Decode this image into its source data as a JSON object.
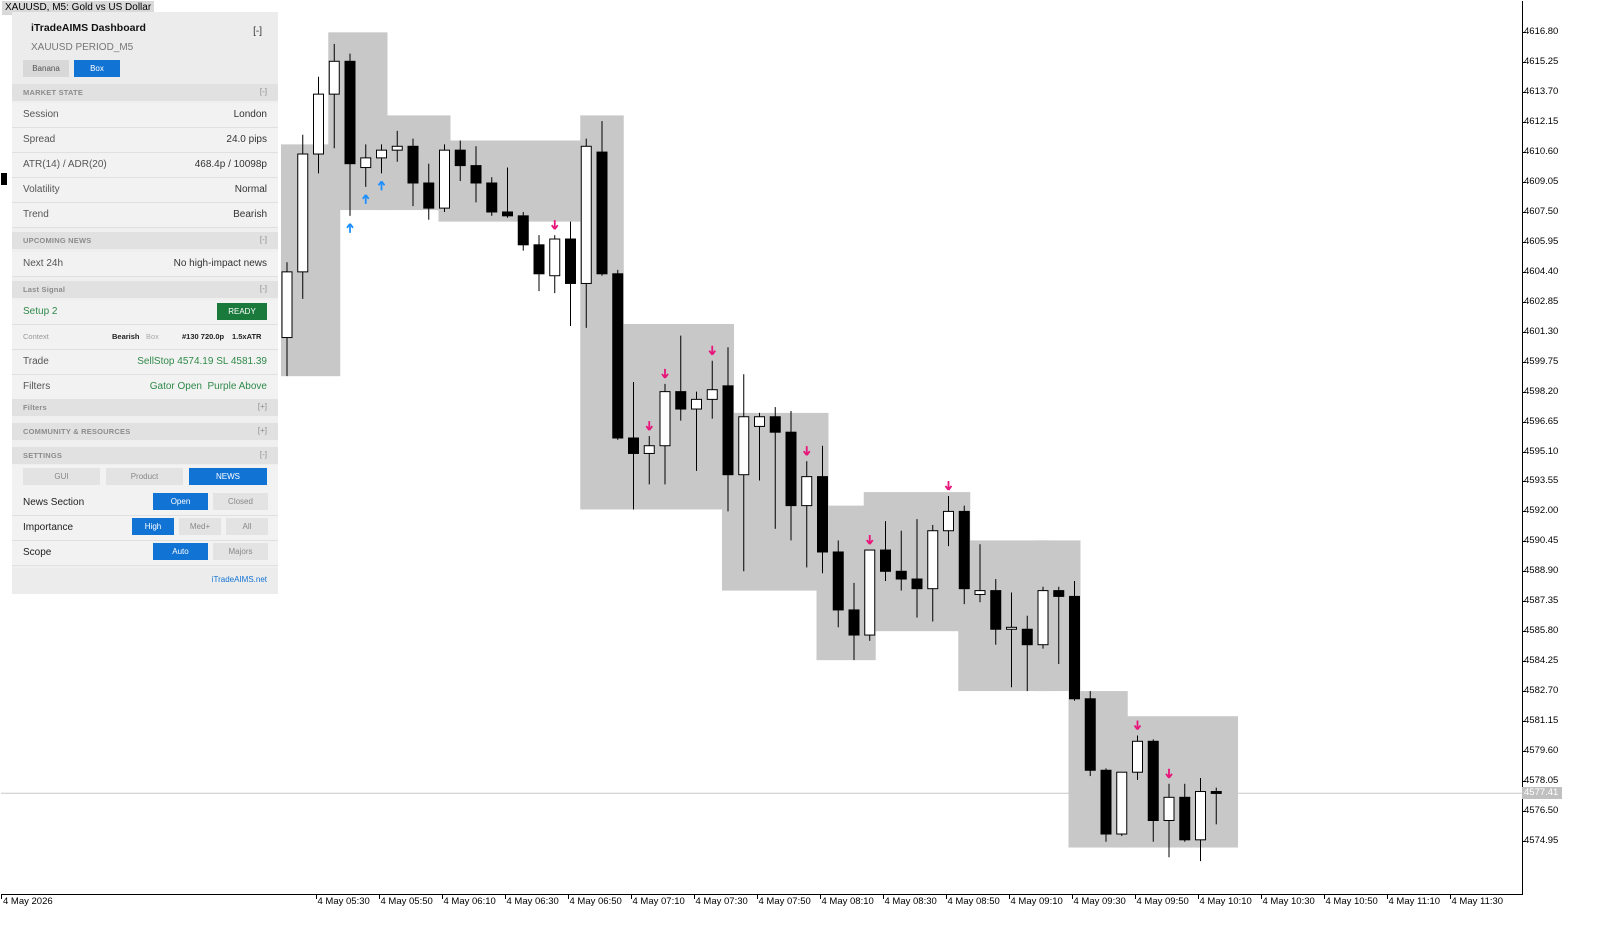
{
  "symbol_title": "XAUUSD, M5:  Gold vs US Dollar",
  "current_price": "4577.41",
  "price_scale": {
    "min": 4573.8,
    "max": 4617.8
  },
  "price_labels": [
    "4616.80",
    "4615.25",
    "4613.70",
    "4612.15",
    "4610.60",
    "4609.05",
    "4607.50",
    "4605.95",
    "4604.40",
    "4602.85",
    "4601.30",
    "4599.75",
    "4598.20",
    "4596.65",
    "4595.10",
    "4593.55",
    "4592.00",
    "4590.45",
    "4588.90",
    "4587.35",
    "4585.80",
    "4584.25",
    "4582.70",
    "4581.15",
    "4579.60",
    "4578.05",
    "4576.50",
    "4574.95"
  ],
  "time_labels": [
    "4 May 2026",
    "4 May 05:30",
    "4 May 05:50",
    "4 May 06:10",
    "4 May 06:30",
    "4 May 06:50",
    "4 May 07:10",
    "4 May 07:30",
    "4 May 07:50",
    "4 May 08:10",
    "4 May 08:30",
    "4 May 08:50",
    "4 May 09:10",
    "4 May 09:30",
    "4 May 09:50",
    "4 May 10:10",
    "4 May 10:30",
    "4 May 10:50",
    "4 May 11:10",
    "4 May 11:30"
  ],
  "colors": {
    "bull": "#ffffff",
    "bear": "#000000",
    "box": "#c8c8c8",
    "arrow_up": "#1e90ff",
    "arrow_down": "#e8157a",
    "accent": "#1173d4",
    "ready": "#1a7a3c"
  },
  "chart_data": {
    "type": "candlestick",
    "timeframe": "M5",
    "candles": [
      {
        "o": 4601.0,
        "h": 4604.9,
        "l": 4599.0,
        "c": 4604.4
      },
      {
        "o": 4604.4,
        "h": 4611.5,
        "l": 4603.0,
        "c": 4610.5
      },
      {
        "o": 4610.5,
        "h": 4614.5,
        "l": 4609.5,
        "c": 4613.6
      },
      {
        "o": 4613.6,
        "h": 4616.2,
        "l": 4610.8,
        "c": 4615.3
      },
      {
        "o": 4615.3,
        "h": 4615.7,
        "l": 4607.3,
        "c": 4610.0
      },
      {
        "o": 4609.8,
        "h": 4611.0,
        "l": 4608.8,
        "c": 4610.3
      },
      {
        "o": 4610.3,
        "h": 4611.0,
        "l": 4609.5,
        "c": 4610.7
      },
      {
        "o": 4610.7,
        "h": 4611.7,
        "l": 4610.1,
        "c": 4610.9
      },
      {
        "o": 4610.9,
        "h": 4611.3,
        "l": 4607.8,
        "c": 4609.0
      },
      {
        "o": 4609.0,
        "h": 4610.0,
        "l": 4607.1,
        "c": 4607.7
      },
      {
        "o": 4607.7,
        "h": 4611.0,
        "l": 4607.5,
        "c": 4610.7
      },
      {
        "o": 4610.7,
        "h": 4611.2,
        "l": 4609.1,
        "c": 4609.9
      },
      {
        "o": 4609.9,
        "h": 4610.9,
        "l": 4608.0,
        "c": 4609.0
      },
      {
        "o": 4609.0,
        "h": 4609.3,
        "l": 4607.3,
        "c": 4607.5
      },
      {
        "o": 4607.5,
        "h": 4609.8,
        "l": 4607.2,
        "c": 4607.3
      },
      {
        "o": 4607.3,
        "h": 4607.5,
        "l": 4605.5,
        "c": 4605.8
      },
      {
        "o": 4605.8,
        "h": 4606.3,
        "l": 4603.4,
        "c": 4604.3
      },
      {
        "o": 4604.2,
        "h": 4606.3,
        "l": 4603.3,
        "c": 4606.1
      },
      {
        "o": 4606.1,
        "h": 4607.0,
        "l": 4601.6,
        "c": 4603.8
      },
      {
        "o": 4603.8,
        "h": 4611.3,
        "l": 4601.5,
        "c": 4610.9
      },
      {
        "o": 4610.6,
        "h": 4612.2,
        "l": 4604.2,
        "c": 4604.3
      },
      {
        "o": 4604.3,
        "h": 4604.5,
        "l": 4595.7,
        "c": 4595.8
      },
      {
        "o": 4595.8,
        "h": 4598.7,
        "l": 4592.1,
        "c": 4595.0
      },
      {
        "o": 4595.0,
        "h": 4595.9,
        "l": 4593.4,
        "c": 4595.4
      },
      {
        "o": 4595.4,
        "h": 4598.6,
        "l": 4593.4,
        "c": 4598.2
      },
      {
        "o": 4598.2,
        "h": 4601.1,
        "l": 4596.7,
        "c": 4597.3
      },
      {
        "o": 4597.3,
        "h": 4598.2,
        "l": 4594.1,
        "c": 4597.8
      },
      {
        "o": 4597.8,
        "h": 4599.8,
        "l": 4596.8,
        "c": 4598.3
      },
      {
        "o": 4598.5,
        "h": 4600.5,
        "l": 4592.0,
        "c": 4593.9
      },
      {
        "o": 4593.9,
        "h": 4599.1,
        "l": 4588.9,
        "c": 4596.9
      },
      {
        "o": 4596.4,
        "h": 4597.1,
        "l": 4593.6,
        "c": 4596.9
      },
      {
        "o": 4596.9,
        "h": 4597.4,
        "l": 4591.1,
        "c": 4596.1
      },
      {
        "o": 4596.1,
        "h": 4597.2,
        "l": 4590.5,
        "c": 4592.3
      },
      {
        "o": 4592.3,
        "h": 4594.6,
        "l": 4589.1,
        "c": 4593.8
      },
      {
        "o": 4593.8,
        "h": 4595.4,
        "l": 4588.8,
        "c": 4589.9
      },
      {
        "o": 4589.9,
        "h": 4590.5,
        "l": 4586.0,
        "c": 4586.9
      },
      {
        "o": 4586.9,
        "h": 4588.3,
        "l": 4584.3,
        "c": 4585.6
      },
      {
        "o": 4585.6,
        "h": 4590.0,
        "l": 4585.3,
        "c": 4590.0
      },
      {
        "o": 4590.0,
        "h": 4591.5,
        "l": 4588.4,
        "c": 4588.9
      },
      {
        "o": 4588.9,
        "h": 4591.0,
        "l": 4587.9,
        "c": 4588.5
      },
      {
        "o": 4588.5,
        "h": 4591.6,
        "l": 4586.5,
        "c": 4588.0
      },
      {
        "o": 4588.0,
        "h": 4591.3,
        "l": 4586.3,
        "c": 4591.0
      },
      {
        "o": 4591.0,
        "h": 4592.8,
        "l": 4590.2,
        "c": 4592.0
      },
      {
        "o": 4592.0,
        "h": 4592.3,
        "l": 4587.2,
        "c": 4588.0
      },
      {
        "o": 4587.7,
        "h": 4590.3,
        "l": 4587.3,
        "c": 4587.9
      },
      {
        "o": 4587.9,
        "h": 4588.5,
        "l": 4585.1,
        "c": 4585.9
      },
      {
        "o": 4585.9,
        "h": 4587.8,
        "l": 4582.9,
        "c": 4586.0
      },
      {
        "o": 4585.9,
        "h": 4586.6,
        "l": 4582.7,
        "c": 4585.1
      },
      {
        "o": 4585.1,
        "h": 4588.1,
        "l": 4584.9,
        "c": 4587.9
      },
      {
        "o": 4587.9,
        "h": 4588.1,
        "l": 4584.1,
        "c": 4587.6
      },
      {
        "o": 4587.6,
        "h": 4588.4,
        "l": 4582.2,
        "c": 4582.3
      },
      {
        "o": 4582.3,
        "h": 4582.7,
        "l": 4578.3,
        "c": 4578.6
      },
      {
        "o": 4578.6,
        "h": 4578.7,
        "l": 4574.9,
        "c": 4575.3
      },
      {
        "o": 4575.3,
        "h": 4578.4,
        "l": 4575.2,
        "c": 4578.5
      },
      {
        "o": 4578.5,
        "h": 4580.4,
        "l": 4578.1,
        "c": 4580.1
      },
      {
        "o": 4580.1,
        "h": 4580.2,
        "l": 4574.9,
        "c": 4576.0
      },
      {
        "o": 4576.0,
        "h": 4577.9,
        "l": 4574.1,
        "c": 4577.2
      },
      {
        "o": 4577.2,
        "h": 4577.9,
        "l": 4574.9,
        "c": 4575.0
      },
      {
        "o": 4575.0,
        "h": 4578.2,
        "l": 4573.9,
        "c": 4577.5
      },
      {
        "o": 4577.5,
        "h": 4577.7,
        "l": 4575.8,
        "c": 4577.4
      }
    ],
    "boxes": [
      {
        "from": 0,
        "to": 3,
        "top": 4611.0,
        "bottom": 4599.0
      },
      {
        "from": 3,
        "to": 6,
        "top": 4616.8,
        "bottom": 4607.6
      },
      {
        "from": 6,
        "to": 10,
        "top": 4612.5,
        "bottom": 4607.6
      },
      {
        "from": 10,
        "to": 19,
        "top": 4611.2,
        "bottom": 4607.0
      },
      {
        "from": 19,
        "to": 21,
        "top": 4612.5,
        "bottom": 4592.1
      },
      {
        "from": 21,
        "to": 28,
        "top": 4601.7,
        "bottom": 4592.1
      },
      {
        "from": 28,
        "to": 34,
        "top": 4597.1,
        "bottom": 4587.9
      },
      {
        "from": 34,
        "to": 37,
        "top": 4592.3,
        "bottom": 4584.3
      },
      {
        "from": 37,
        "to": 43,
        "top": 4593.0,
        "bottom": 4585.8
      },
      {
        "from": 43,
        "to": 48,
        "top": 4590.5,
        "bottom": 4582.7
      },
      {
        "from": 48,
        "to": 50,
        "top": 4590.5,
        "bottom": 4582.7
      },
      {
        "from": 50,
        "to": 53,
        "top": 4582.7,
        "bottom": 4574.6
      },
      {
        "from": 53,
        "to": 60,
        "top": 4581.4,
        "bottom": 4574.6
      }
    ],
    "arrows_up": [
      4,
      5,
      6
    ],
    "arrows_down": [
      17,
      23,
      24,
      27,
      33,
      37,
      42,
      54,
      56
    ]
  },
  "dashboard": {
    "title": "iTradeAIMS Dashboard",
    "collapse": "[-]",
    "subtitle": "XAUUSD PERIOD_M5",
    "mode_buttons": [
      "Banana",
      "Box"
    ],
    "market_state": {
      "header": "MARKET STATE",
      "toggle": "[-]",
      "rows": [
        {
          "label": "Session",
          "value": "London"
        },
        {
          "label": "Spread",
          "value": "24.0 pips"
        },
        {
          "label": "ATR(14) / ADR(20)",
          "value": "468.4p / 10098p"
        },
        {
          "label": "Volatility",
          "value": "Normal"
        },
        {
          "label": "Trend",
          "value": "Bearish"
        }
      ]
    },
    "upcoming_news": {
      "header": "UPCOMING NEWS",
      "toggle": "[-]",
      "label": "Next 24h",
      "value": "No high-impact news"
    },
    "last_signal": {
      "header": "Last Signal",
      "toggle": "[-]",
      "setup": "Setup 2",
      "status": "READY",
      "context_label": "Context",
      "context_trend": "Bearish",
      "context_box": "Box",
      "context_info": "#130 720.0p",
      "context_atr": "1.5xATR",
      "trade_label": "Trade",
      "trade_value": "SellStop 4574.19 SL 4581.39",
      "filters_label": "Filters",
      "filter_1": "Gator Open",
      "filter_2": "Purple Above"
    },
    "filters_section": {
      "header": "Filters",
      "toggle": "[+]"
    },
    "community": {
      "header": "COMMUNITY & RESOURCES",
      "toggle": "[+]"
    },
    "settings": {
      "header": "SETTINGS",
      "toggle": "[-]",
      "tabs": [
        "GUI",
        "Product",
        "NEWS"
      ],
      "news_section_label": "News Section",
      "news_section_options": [
        "Open",
        "Closed"
      ],
      "importance_label": "Importance",
      "importance_options": [
        "High",
        "Med+",
        "All"
      ],
      "scope_label": "Scope",
      "scope_options": [
        "Auto",
        "Majors"
      ]
    },
    "footer_link": "iTradeAIMS.net"
  }
}
